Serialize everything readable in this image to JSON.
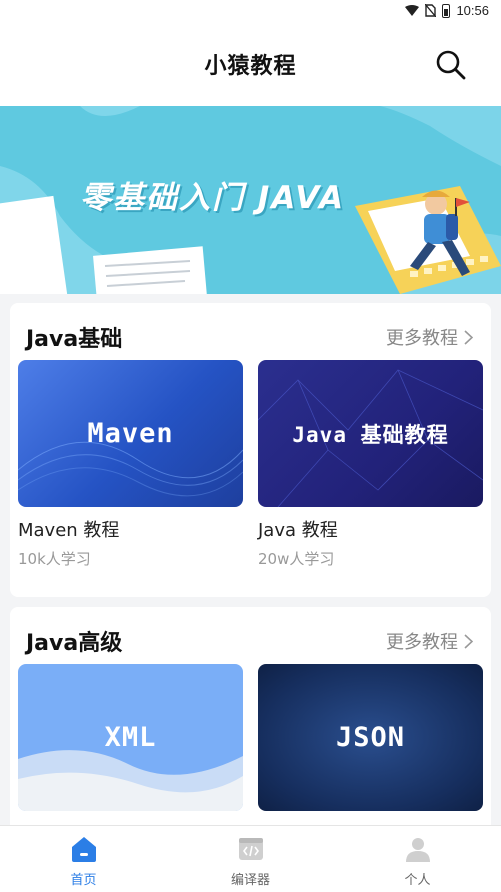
{
  "status_bar": {
    "time": "10:56"
  },
  "header": {
    "title": "小猿教程"
  },
  "banner": {
    "text": "零基础入门 JAVA"
  },
  "sections": [
    {
      "title": "Java基础",
      "more_label": "更多教程",
      "courses": [
        {
          "thumb_text": "Maven",
          "name": "Maven 教程",
          "learners": "10k人学习"
        },
        {
          "thumb_text": "Java 基础教程",
          "name": "Java 教程",
          "learners": "20w人学习"
        }
      ]
    },
    {
      "title": "Java高级",
      "more_label": "更多教程",
      "courses": [
        {
          "thumb_text": "XML",
          "name": "",
          "learners": ""
        },
        {
          "thumb_text": "JSON",
          "name": "",
          "learners": ""
        }
      ]
    }
  ],
  "tabbar": {
    "items": [
      {
        "label": "首页",
        "icon": "home-icon",
        "active": true
      },
      {
        "label": "编译器",
        "icon": "code-icon",
        "active": false
      },
      {
        "label": "个人",
        "icon": "person-icon",
        "active": false
      }
    ]
  },
  "colors": {
    "accent": "#2b7ee6",
    "banner_bg": "#5fc9e0"
  }
}
